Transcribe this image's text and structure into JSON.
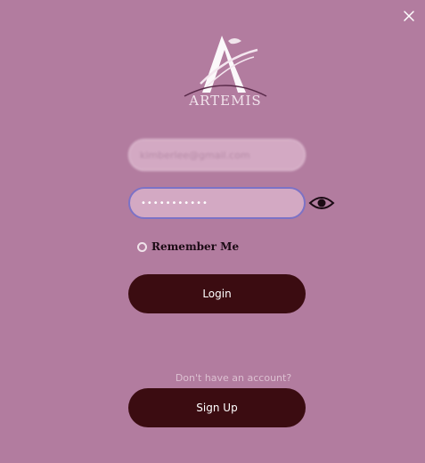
{
  "window": {
    "close_icon": "close-icon"
  },
  "brand": {
    "logo_icon": "artemis-logo-icon",
    "name": "ARTEMIS"
  },
  "form": {
    "email_value": "kimberlee@gmail.com",
    "password_value": "•••••••••••",
    "password_toggle_icon": "eye-icon",
    "remember_label": "Remember Me",
    "remember_checked": false,
    "login_label": "Login"
  },
  "signup": {
    "prompt": "Don't have an account?",
    "button_label": "Sign Up"
  },
  "colors": {
    "background": "#b27c9f",
    "field_fill": "#d3a9c3",
    "focus_border": "#7c72c6",
    "button": "#3b0c11"
  }
}
